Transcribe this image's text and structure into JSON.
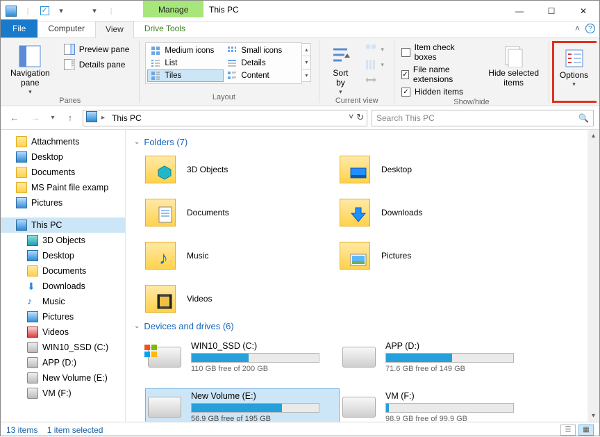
{
  "titlebar": {
    "manage": "Manage",
    "title": "This PC"
  },
  "tabs": {
    "file": "File",
    "computer": "Computer",
    "view": "View",
    "drivetools": "Drive Tools"
  },
  "ribbon": {
    "panes": {
      "nav": "Navigation\npane",
      "preview": "Preview pane",
      "details": "Details pane",
      "group": "Panes"
    },
    "layout": {
      "medium": "Medium icons",
      "small": "Small icons",
      "list": "List",
      "details": "Details",
      "tiles": "Tiles",
      "content": "Content",
      "group": "Layout"
    },
    "current": {
      "sortby": "Sort\nby",
      "group": "Current view"
    },
    "showhide": {
      "itemchk": "Item check boxes",
      "ext": "File name extensions",
      "hidden": "Hidden items",
      "hidesel": "Hide selected\nitems",
      "group": "Show/hide"
    },
    "options": "Options"
  },
  "addressbar": {
    "crumb": "This PC",
    "search_placeholder": "Search This PC"
  },
  "tree": {
    "attachments": "Attachments",
    "desktop": "Desktop",
    "documents": "Documents",
    "mspaint": "MS Paint file examp",
    "pictures": "Pictures",
    "thispc": "This PC",
    "threed": "3D Objects",
    "desktop2": "Desktop",
    "documents2": "Documents",
    "downloads": "Downloads",
    "music": "Music",
    "pictures2": "Pictures",
    "videos": "Videos",
    "win10": "WIN10_SSD (C:)",
    "app": "APP (D:)",
    "newvol": "New Volume (E:)",
    "vm": "VM (F:)"
  },
  "sections": {
    "folders": "Folders (7)",
    "devices": "Devices and drives (6)"
  },
  "folders": {
    "threed": "3D Objects",
    "desktop": "Desktop",
    "documents": "Documents",
    "downloads": "Downloads",
    "music": "Music",
    "pictures": "Pictures",
    "videos": "Videos"
  },
  "drives": [
    {
      "name": "WIN10_SSD (C:)",
      "free": "110 GB free of 200 GB",
      "pct": 45
    },
    {
      "name": "APP (D:)",
      "free": "71.6 GB free of 149 GB",
      "pct": 52
    },
    {
      "name": "New Volume (E:)",
      "free": "56.9 GB free of 195 GB",
      "pct": 71,
      "selected": true
    },
    {
      "name": "VM (F:)",
      "free": "98.9 GB free of 99.9 GB",
      "pct": 1
    }
  ],
  "status": {
    "items": "13 items",
    "selected": "1 item selected"
  }
}
